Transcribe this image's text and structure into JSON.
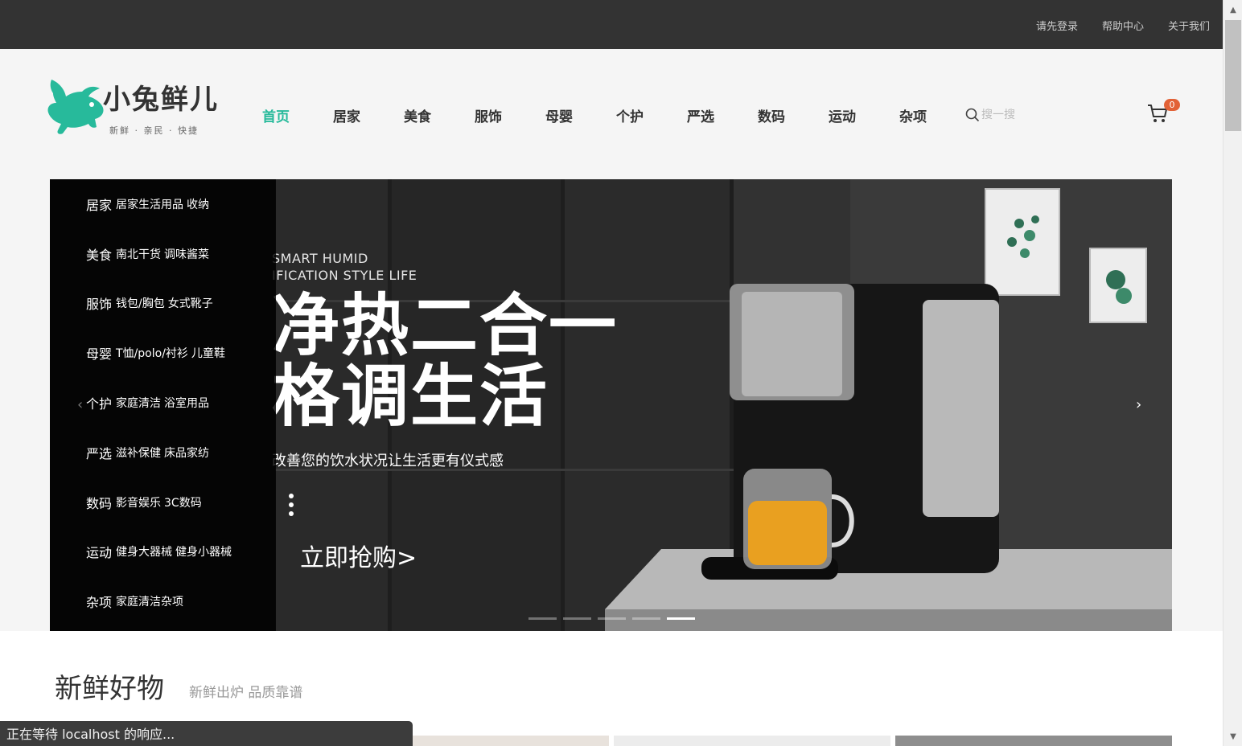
{
  "topbar": {
    "links": [
      "请先登录",
      "帮助中心",
      "关于我们"
    ]
  },
  "logo": {
    "name": "小兔鲜儿",
    "slogan": "新鲜 · 亲民 · 快捷"
  },
  "nav": {
    "items": [
      "首页",
      "居家",
      "美食",
      "服饰",
      "母婴",
      "个护",
      "严选",
      "数码",
      "运动",
      "杂项"
    ],
    "active_index": 0
  },
  "search": {
    "placeholder": "搜一搜"
  },
  "cart": {
    "count": "0"
  },
  "categories": [
    {
      "name": "居家",
      "subs": [
        "居家生活用品",
        "收纳"
      ]
    },
    {
      "name": "美食",
      "subs": [
        "南北干货",
        "调味酱菜"
      ]
    },
    {
      "name": "服饰",
      "subs": [
        "钱包/胸包",
        "女式靴子"
      ]
    },
    {
      "name": "母婴",
      "subs": [
        "T恤/polo/衬衫",
        "儿童鞋"
      ]
    },
    {
      "name": "个护",
      "subs": [
        "家庭清洁",
        "浴室用品"
      ]
    },
    {
      "name": "严选",
      "subs": [
        "滋补保健",
        "床品家纺"
      ]
    },
    {
      "name": "数码",
      "subs": [
        "影音娱乐",
        "3C数码"
      ]
    },
    {
      "name": "运动",
      "subs": [
        "健身大器械",
        "健身小器械"
      ]
    },
    {
      "name": "杂项",
      "subs": [
        "家庭清洁杂项"
      ]
    }
  ],
  "banner": {
    "en_line1": "SMART HUMID",
    "en_line2": "IFICATION STYLE LIFE",
    "headline1": "净热二合一",
    "headline2": "格调生活",
    "desc": "改善您的饮水状况让生活更有仪式感",
    "cta": "立即抢购>",
    "slide_count": 5,
    "active_slide": 4
  },
  "section": {
    "title": "新鲜好物",
    "subtitle": "新鲜出炉 品质靠谱"
  },
  "status": {
    "text": "正在等待 localhost 的响应..."
  },
  "colors": {
    "brand": "#27ba9b",
    "badge": "#e26237",
    "topbar": "#333333"
  }
}
